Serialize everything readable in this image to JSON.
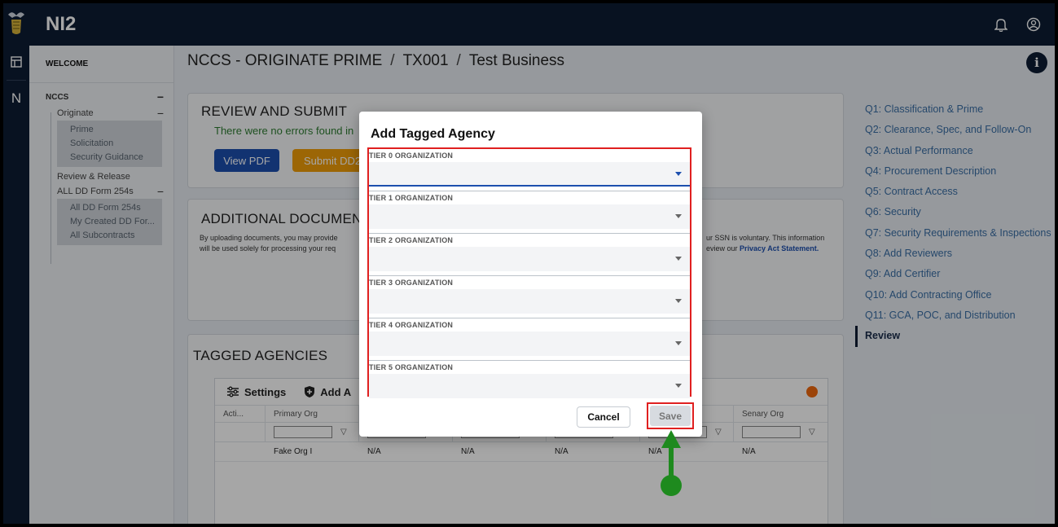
{
  "app": {
    "name": "NI2"
  },
  "left_nav": {
    "welcome": "WELCOME",
    "nccs": "NCCS",
    "originate": "Originate",
    "originate_items": [
      "Prime",
      "Solicitation",
      "Security Guidance"
    ],
    "review_release": "Review & Release",
    "all_dd": "ALL DD Form 254s",
    "all_dd_items": [
      "All DD Form 254s",
      "My Created DD For...",
      "All Subcontracts"
    ],
    "rail_letter": "N"
  },
  "breadcrumb": {
    "part1": "NCCS - ORIGINATE PRIME",
    "part2": "TX001",
    "part3": "Test Business",
    "separator": "/"
  },
  "review": {
    "title": "REVIEW AND SUBMIT",
    "message": "There were no errors found in",
    "view_pdf": "View PDF",
    "submit": "Submit DD2"
  },
  "docs": {
    "title": "ADDITIONAL DOCUMEN",
    "line1": "By uploading documents, you may provide",
    "line2": "will be used solely for processing your req",
    "right_line1": "ur SSN is voluntary. This information",
    "right_line2_prefix": "eview our ",
    "privacy_link": "Privacy Act Statement."
  },
  "tagged": {
    "title": "TAGGED AGENCIES",
    "settings": "Settings",
    "add": "Add A",
    "columns": [
      "Acti...",
      "Primary Org",
      "",
      "",
      "",
      "",
      "Senary Org"
    ],
    "row": [
      "",
      "Fake Org I",
      "N/A",
      "N/A",
      "N/A",
      "N/A",
      "N/A"
    ]
  },
  "right_nav": {
    "items": [
      "Q1: Classification & Prime",
      "Q2: Clearance, Spec, and Follow-On",
      "Q3: Actual Performance",
      "Q4: Procurement Description",
      "Q5: Contract Access",
      "Q6: Security",
      "Q7: Security Requirements & Inspections",
      "Q8: Add Reviewers",
      "Q9: Add Certifier",
      "Q10: Add Contracting Office",
      "Q11: GCA, POC, and Distribution"
    ],
    "active": "Review"
  },
  "modal": {
    "title": "Add Tagged Agency",
    "tiers": [
      "TIER 0 ORGANIZATION",
      "TIER 1 ORGANIZATION",
      "TIER 2 ORGANIZATION",
      "TIER 3 ORGANIZATION",
      "TIER 4 ORGANIZATION",
      "TIER 5 ORGANIZATION"
    ],
    "cancel": "Cancel",
    "save": "Save"
  },
  "colors": {
    "topbar": "#0d1c33",
    "primary": "#1d4fae",
    "accent_orange": "#f09d08",
    "highlight": "#e02020",
    "pointer": "#1e8a1e"
  }
}
